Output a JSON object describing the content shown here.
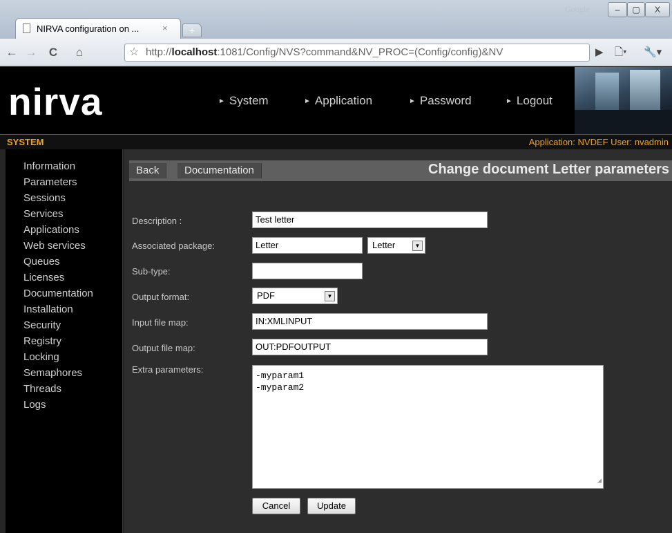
{
  "browser": {
    "tab_title": "NIRVA configuration on ...",
    "tab_close": "×",
    "new_tab": "+",
    "search_engine_label": "Google",
    "url_prefix": "http://",
    "url_host": "localhost",
    "url_rest": ":1081/Config/NVS?command&NV_PROC=(Config/config)&NV",
    "nav": {
      "back": "←",
      "forward": "→",
      "reload": "C",
      "home": "⌂"
    },
    "toolbar": {
      "play": "▶",
      "page_menu": "🗋▾",
      "wrench_menu": "🔧▾"
    },
    "window": {
      "minimize": "–",
      "maximize": "▢",
      "close": "X"
    }
  },
  "app": {
    "logo": "nirva",
    "top_nav": [
      "System",
      "Application",
      "Password",
      "Logout"
    ],
    "section": "SYSTEM",
    "app_info": "Application: NVDEF  User: nvadmin"
  },
  "sidebar": {
    "items": [
      "Information",
      "Parameters",
      "Sessions",
      "Services",
      "Applications",
      "Web services",
      "Queues",
      "Licenses",
      "Documentation",
      "Installation",
      "Security",
      "Registry",
      "Locking",
      "Semaphores",
      "Threads",
      "Logs"
    ]
  },
  "main": {
    "back_label": "Back",
    "documentation_label": "Documentation",
    "form_title": "Change document Letter parameters",
    "labels": {
      "description": "Description :",
      "package": "Associated package:",
      "subtype": "Sub-type:",
      "output_format": "Output format:",
      "input_map": "Input file map:",
      "output_map": "Output file map:",
      "extra": "Extra parameters:"
    },
    "values": {
      "description": "Test letter",
      "package": "Letter",
      "package_select": "Letter",
      "subtype": "",
      "output_format": "PDF",
      "input_map": "IN:XMLINPUT",
      "output_map": "OUT:PDFOUTPUT",
      "extra_line1": "-myparam1",
      "extra_line2": "-myparam2"
    },
    "cancel_label": "Cancel",
    "update_label": "Update"
  }
}
